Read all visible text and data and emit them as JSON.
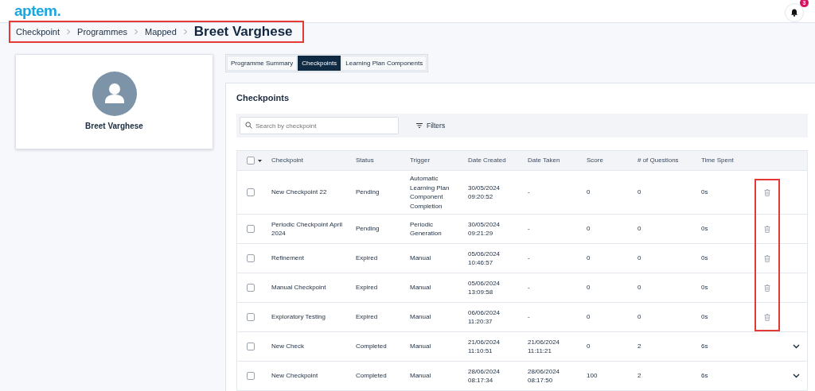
{
  "header": {
    "logo": "aptem.",
    "notifications": {
      "count": "3"
    }
  },
  "breadcrumb": {
    "highlighted": true,
    "items": [
      "Checkpoint",
      "Programmes",
      "Mapped"
    ],
    "current": "Breet Varghese"
  },
  "profile": {
    "name": "Breet Varghese"
  },
  "tabs": [
    {
      "label": "Programme Summary",
      "selected": false
    },
    {
      "label": "Checkpoints",
      "selected": true
    },
    {
      "label": "Learning Plan Components",
      "selected": false
    }
  ],
  "panel": {
    "title": "Checkpoints",
    "search": {
      "placeholder": "Search by checkpoint"
    },
    "filters": "Filters"
  },
  "table": {
    "select_all_checked": false,
    "delete_column_highlighted": true,
    "columns": [
      "Checkpoint",
      "Status",
      "Trigger",
      "Date Created",
      "Date Taken",
      "Score",
      "# of Questions",
      "Time Spent"
    ],
    "rows": [
      {
        "checked": false,
        "kind": "delete",
        "cells": [
          "New Checkpoint 22",
          "Pending",
          "Automatic Learning Plan Component Completion",
          "30/05/2024 09:20:52",
          "-",
          "0",
          "0",
          "0s"
        ]
      },
      {
        "checked": false,
        "kind": "delete",
        "cells": [
          "Periodic Checkpoint April 2024",
          "Pending",
          "Periodic Generation",
          "30/05/2024 09:21:29",
          "-",
          "0",
          "0",
          "0s"
        ]
      },
      {
        "checked": false,
        "kind": "delete",
        "cells": [
          "Refinement",
          "Expired",
          "Manual",
          "05/06/2024 10:46:57",
          "-",
          "0",
          "0",
          "0s"
        ]
      },
      {
        "checked": false,
        "kind": "delete",
        "cells": [
          "Manual Checkpoint",
          "Expired",
          "Manual",
          "05/06/2024 13:09:58",
          "-",
          "0",
          "0",
          "0s"
        ]
      },
      {
        "checked": false,
        "kind": "delete",
        "cells": [
          "Exploratory Testing",
          "Expired",
          "Manual",
          "06/06/2024 11:20:37",
          "-",
          "0",
          "0",
          "0s"
        ]
      },
      {
        "checked": false,
        "kind": "expand",
        "cells": [
          "New Check",
          "Completed",
          "Manual",
          "21/06/2024 11:10:51",
          "21/06/2024 11:11:21",
          "0",
          "2",
          "6s"
        ]
      },
      {
        "checked": false,
        "kind": "expand",
        "cells": [
          "New Checkpoint",
          "Completed",
          "Manual",
          "28/06/2024 08:17:34",
          "28/06/2024 08:17:50",
          "100",
          "2",
          "6s"
        ]
      }
    ]
  }
}
